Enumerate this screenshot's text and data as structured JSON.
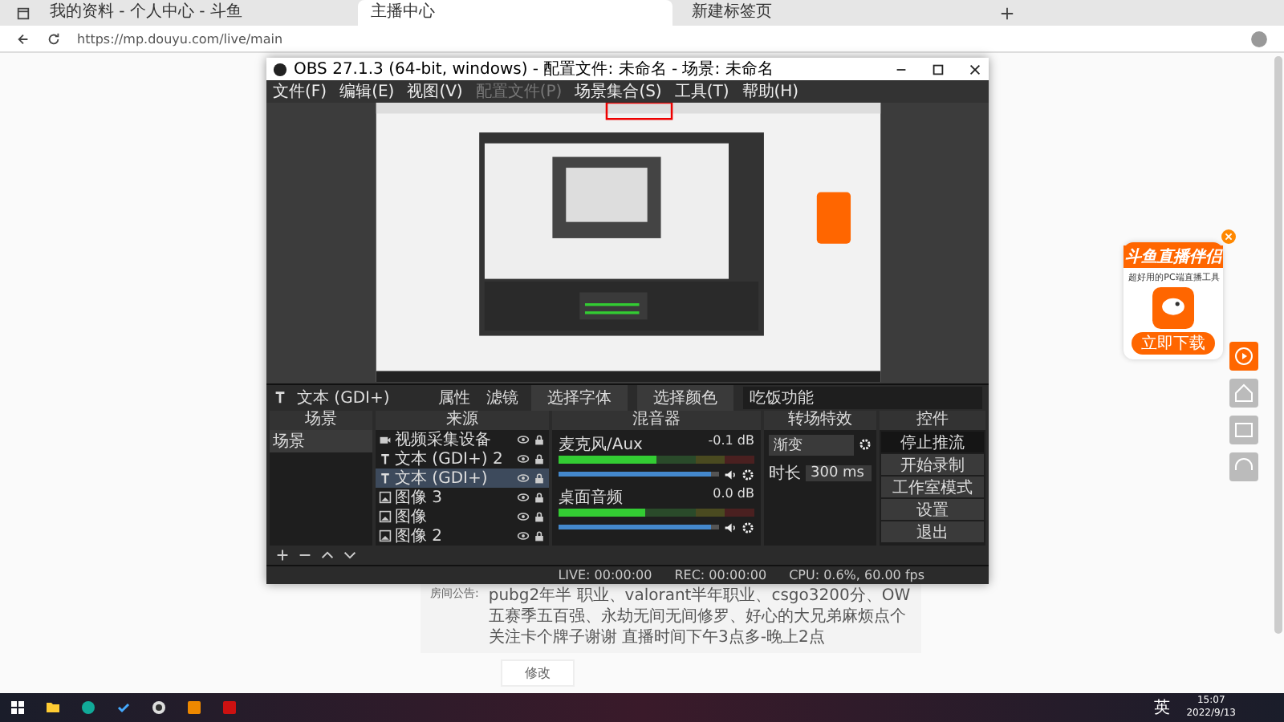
{
  "browser": {
    "tabs": [
      {
        "title": "我的资料 - 个人中心 - 斗鱼",
        "selected": false
      },
      {
        "title": "主播中心",
        "selected": true
      },
      {
        "title": "新建标签页",
        "selected": false
      }
    ],
    "url": "https://mp.douyu.com/live/main"
  },
  "obs": {
    "title": "OBS 27.1.3 (64-bit, windows) - 配置文件: 未命名 - 场景: 未命名",
    "menu": [
      {
        "label": "文件(F)",
        "disabled": false
      },
      {
        "label": "编辑(E)",
        "disabled": false
      },
      {
        "label": "视图(V)",
        "disabled": false
      },
      {
        "label": "配置文件(P)",
        "disabled": true
      },
      {
        "label": "场景集合(S)",
        "disabled": false
      },
      {
        "label": "工具(T)",
        "disabled": false
      },
      {
        "label": "帮助(H)",
        "disabled": false
      }
    ],
    "toolbar": {
      "source_name": "文本 (GDI+)",
      "buttons": [
        "属性",
        "滤镜"
      ],
      "fields": [
        "选择字体",
        "选择颜色"
      ],
      "text_value": "吃饭功能"
    },
    "scenes": {
      "title": "场景",
      "items": [
        {
          "name": "场景",
          "selected": true
        }
      ]
    },
    "sources": {
      "title": "来源",
      "items": [
        {
          "kind": "camera",
          "name": "视频采集设备",
          "selected": false
        },
        {
          "kind": "text",
          "name": "文本 (GDI+) 2",
          "selected": false
        },
        {
          "kind": "text",
          "name": "文本 (GDI+)",
          "selected": true
        },
        {
          "kind": "image",
          "name": "图像 3",
          "selected": false
        },
        {
          "kind": "image",
          "name": "图像",
          "selected": false
        },
        {
          "kind": "image",
          "name": "图像 2",
          "selected": false
        }
      ]
    },
    "mixer": {
      "title": "混音器",
      "channels": [
        {
          "name": "麦克风/Aux",
          "reading": "-0.1 dB",
          "level": 0.5,
          "volume": {
            "level": 0.95
          }
        },
        {
          "name": "桌面音频",
          "reading": "0.0 dB",
          "level": 0.44,
          "volume": {
            "level": 0.95
          }
        }
      ]
    },
    "transitions": {
      "title": "转场特效",
      "type": "渐变",
      "duration_label": "时长",
      "duration": "300 ms"
    },
    "controls": {
      "title": "控件",
      "buttons": [
        {
          "label": "停止推流",
          "active": true
        },
        {
          "label": "开始录制",
          "active": false
        },
        {
          "label": "工作室模式",
          "active": false
        },
        {
          "label": "设置",
          "active": false
        },
        {
          "label": "退出",
          "active": false
        }
      ]
    },
    "status": [
      "LIVE: 00:00:00",
      "REC: 00:00:00",
      "CPU: 0.6%, 60.00 fps"
    ]
  },
  "promo": {
    "title": "斗鱼直播伴侣",
    "subtitle": "超好用的PC端直播工具",
    "button": "立即下载"
  },
  "announcement": {
    "label": "房间公告:",
    "text": "pubg2年半 职业、valorant半年职业、csgo3200分、OW五赛季五百强、永劫无间无间修罗、好心的大兄弟麻烦点个关注卡个牌子谢谢 直播时间下午3点多-晚上2点",
    "button": "修改"
  },
  "taskbar": {
    "ime": "英",
    "time": "15:07",
    "date": "2022/9/13"
  }
}
